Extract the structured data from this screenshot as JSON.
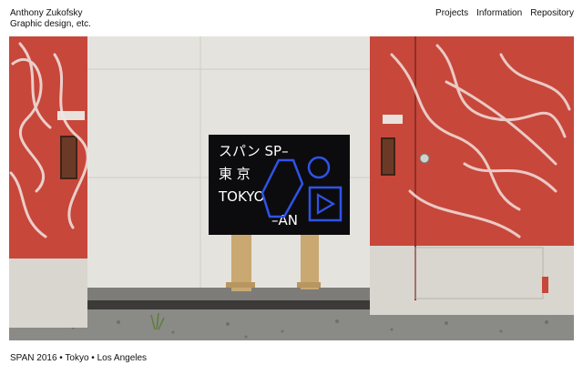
{
  "site": {
    "name": "Anthony Zukofsky",
    "tagline": "Graphic design, etc."
  },
  "nav": {
    "items": [
      {
        "label": "Projects"
      },
      {
        "label": "Information"
      },
      {
        "label": "Repository"
      }
    ]
  },
  "hero": {
    "sign": {
      "line1": "スパン SP–",
      "line2": "東 京",
      "line3": "TOKYO",
      "line4": "–AN"
    },
    "colors": {
      "wall": "#e4e3de",
      "door": "#c7473b",
      "sign_background": "#0c0c0e",
      "sign_text": "#ffffff",
      "sign_accent": "#2f53e8",
      "ground": "#8a8a86"
    }
  },
  "caption": {
    "text": "SPAN 2016 • Tokyo • Los Angeles"
  }
}
